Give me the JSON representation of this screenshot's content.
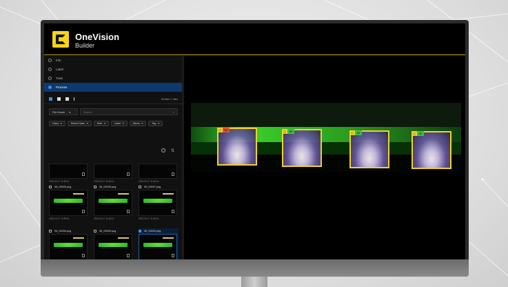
{
  "app": {
    "title": "OneVision",
    "subtitle": "Builder"
  },
  "nav": {
    "items": [
      {
        "label": "Info",
        "active": false
      },
      {
        "label": "Label",
        "active": false
      },
      {
        "label": "Train",
        "active": false
      },
      {
        "label": "Process",
        "active": true
      }
    ]
  },
  "toolbar": {
    "count_text": "0/0 files / 1 files",
    "icons": [
      "square-icon",
      "trash-icon",
      "folder-icon",
      "more-icon"
    ]
  },
  "filters": {
    "sort_label": "File Name",
    "search_placeholder": "Search",
    "chips": [
      "Class",
      "Result Class",
      "Role",
      "Label",
      "Memo",
      "Tag"
    ]
  },
  "files": [
    {
      "name": "",
      "date": "2023-03-17 11:48:14",
      "checked": false,
      "has_image": false
    },
    {
      "name": "",
      "date": "2023-03-17 11:48:14",
      "checked": false,
      "has_image": false
    },
    {
      "name": "",
      "date": "2023-03-17 11:48:14",
      "checked": false,
      "has_image": false
    },
    {
      "name": "06_00005.png",
      "date": "2023-03-17 11:48:14",
      "checked": false,
      "has_image": true
    },
    {
      "name": "06_00006.png",
      "date": "2023-03-17 11:48:14",
      "checked": false,
      "has_image": true
    },
    {
      "name": "06_00007.png",
      "date": "2023-03-17 11:48:14",
      "checked": false,
      "has_image": true
    },
    {
      "name": "06_00008.png",
      "date": "2023-03-17 11:48:14",
      "checked": false,
      "has_image": true
    },
    {
      "name": "06_00009.png",
      "date": "2023-03-17 11:48:14",
      "checked": false,
      "has_image": true
    },
    {
      "name": "06_00000.png",
      "date": "2023-03-17 11:48:14",
      "checked": true,
      "has_image": true
    }
  ],
  "detections": [
    {
      "tag": "NG",
      "color": "#e0562a"
    },
    {
      "tag": "OK",
      "color": "#3fbf3f"
    },
    {
      "tag": "OK",
      "color": "#3fbf3f"
    },
    {
      "tag": "OK",
      "color": "#3fbf3f"
    }
  ],
  "colors": {
    "accent": "#f7d417",
    "active_nav": "#0d3a6e",
    "box_border": "#f2d22a"
  }
}
